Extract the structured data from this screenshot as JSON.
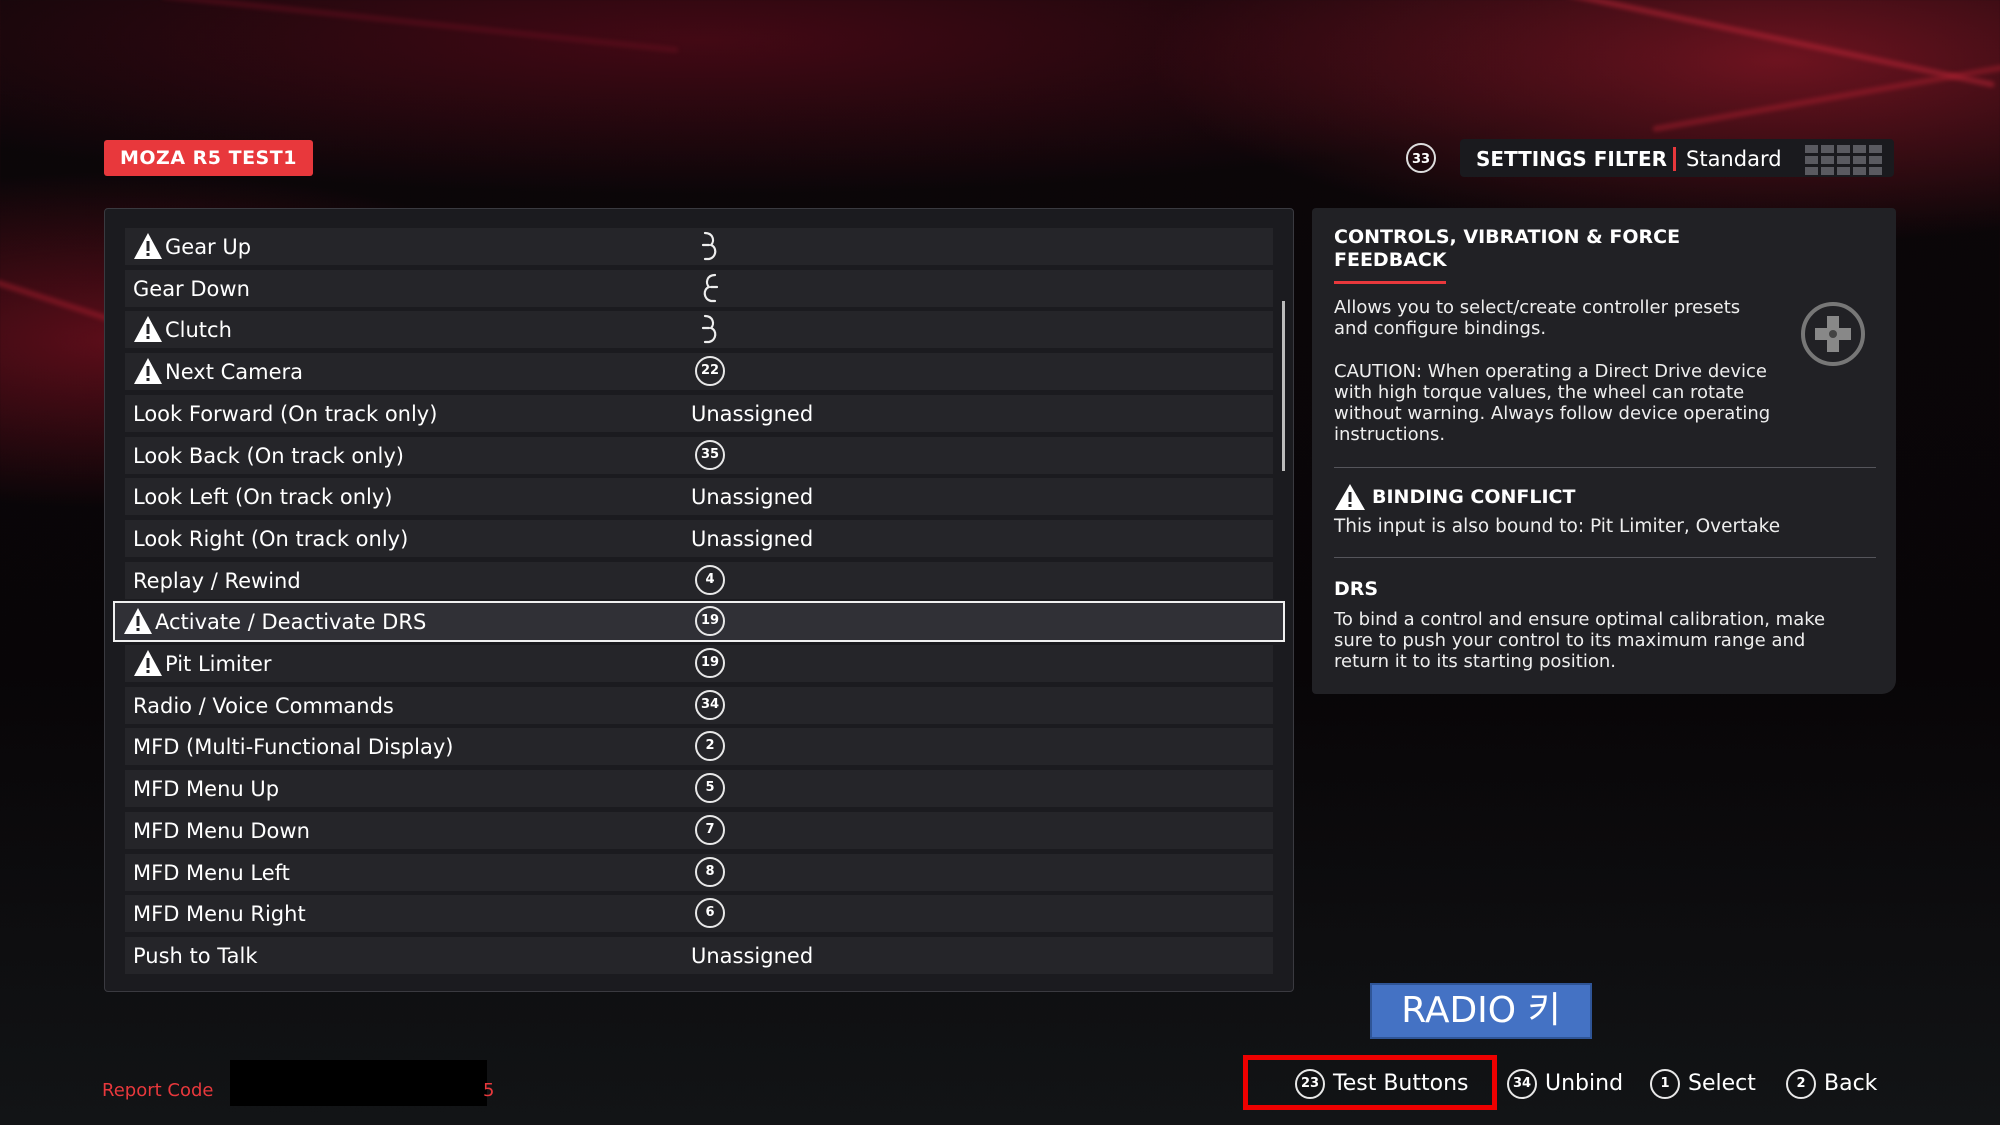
{
  "header": {
    "profile_name": "MOZA R5 TEST1",
    "filter_button": "33",
    "filter_label": "SETTINGS FILTER",
    "filter_value": "Standard"
  },
  "bindings": [
    {
      "label": "Gear Up",
      "warning": true,
      "binding_type": "paddle-right",
      "binding": ""
    },
    {
      "label": "Gear Down",
      "warning": false,
      "binding_type": "paddle-left",
      "binding": ""
    },
    {
      "label": "Clutch",
      "warning": true,
      "binding_type": "paddle-right",
      "binding": ""
    },
    {
      "label": "Next Camera",
      "warning": true,
      "binding_type": "button",
      "binding": "22"
    },
    {
      "label": "Look Forward (On track only)",
      "warning": false,
      "binding_type": "text",
      "binding": "Unassigned"
    },
    {
      "label": "Look Back (On track only)",
      "warning": false,
      "binding_type": "button",
      "binding": "35"
    },
    {
      "label": "Look Left (On track only)",
      "warning": false,
      "binding_type": "text",
      "binding": "Unassigned"
    },
    {
      "label": "Look Right (On track only)",
      "warning": false,
      "binding_type": "text",
      "binding": "Unassigned"
    },
    {
      "label": "Replay / Rewind",
      "warning": false,
      "binding_type": "button",
      "binding": "4"
    },
    {
      "label": "Activate / Deactivate DRS",
      "warning": true,
      "binding_type": "button",
      "binding": "19",
      "selected": true
    },
    {
      "label": "Pit Limiter",
      "warning": true,
      "binding_type": "button",
      "binding": "19"
    },
    {
      "label": "Radio / Voice Commands",
      "warning": false,
      "binding_type": "button",
      "binding": "34"
    },
    {
      "label": "MFD (Multi-Functional Display)",
      "warning": false,
      "binding_type": "button",
      "binding": "2"
    },
    {
      "label": "MFD Menu Up",
      "warning": false,
      "binding_type": "button",
      "binding": "5"
    },
    {
      "label": "MFD Menu Down",
      "warning": false,
      "binding_type": "button",
      "binding": "7"
    },
    {
      "label": "MFD Menu Left",
      "warning": false,
      "binding_type": "button",
      "binding": "8"
    },
    {
      "label": "MFD Menu Right",
      "warning": false,
      "binding_type": "button",
      "binding": "6"
    },
    {
      "label": "Push to Talk",
      "warning": false,
      "binding_type": "text",
      "binding": "Unassigned"
    }
  ],
  "info": {
    "title": "CONTROLS, VIBRATION & FORCE FEEDBACK",
    "desc1": "Allows you to select/create controller presets and configure bindings.",
    "desc2": "CAUTION: When operating a Direct Drive device with high torque values, the wheel can rotate without warning. Always follow device operating instructions.",
    "conflict_title": "BINDING CONFLICT",
    "conflict_text": "This input is also bound to: Pit Limiter, Overtake",
    "drs_title": "DRS",
    "drs_text": "To bind a control and ensure optimal calibration, make sure to push your control to its maximum range and return it to its starting position."
  },
  "footer": {
    "report_label": "Report Code",
    "report_tail": "5",
    "overlay_label": "RADIO 키",
    "hints": [
      {
        "button": "23",
        "label": "Test Buttons"
      },
      {
        "button": "34",
        "label": "Unbind"
      },
      {
        "button": "1",
        "label": "Select"
      },
      {
        "button": "2",
        "label": "Back"
      }
    ]
  },
  "colors": {
    "accent": "#e8383c",
    "overlay_blue": "#4472c4",
    "highlight_box": "#ee0000"
  }
}
